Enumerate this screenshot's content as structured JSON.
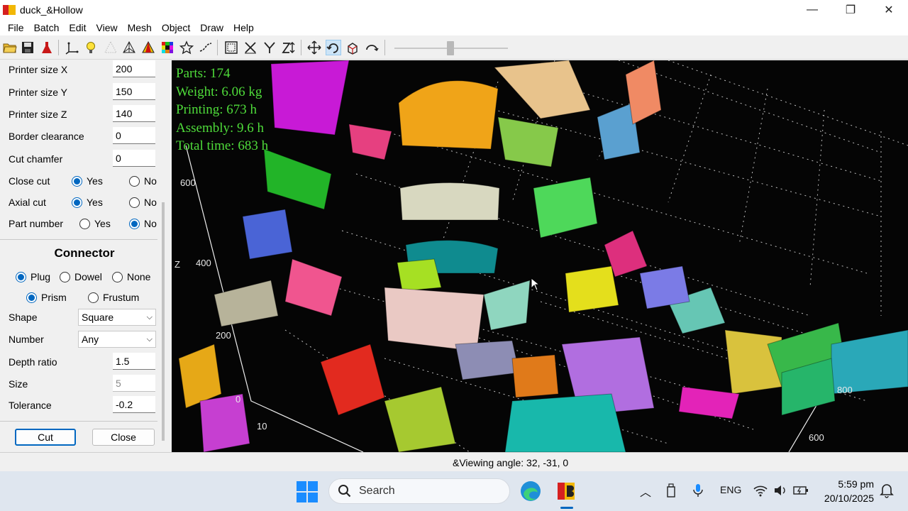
{
  "window": {
    "title": "duck_&Hollow",
    "minimize": "—",
    "maximize": "❐",
    "close": "✕"
  },
  "menu": [
    "File",
    "Batch",
    "Edit",
    "View",
    "Mesh",
    "Object",
    "Draw",
    "Help"
  ],
  "toolbar": {
    "icons": [
      "open-folder-icon",
      "save-icon",
      "flask-icon",
      "axes-icon",
      "lightbulb-icon",
      "grid-dots-icon",
      "wireframe-icon",
      "warning-triangle-icon",
      "color-grid-icon",
      "star-icon",
      "wave-icon",
      "select-box-icon",
      "cut-x-icon",
      "cut-y-icon",
      "cut-z-icon",
      "move-icon",
      "rotate-icon",
      "explode-icon",
      "undo-arc-icon"
    ],
    "zoom_level": 0.5
  },
  "panel": {
    "printer_size_x": {
      "label": "Printer size X",
      "value": "200"
    },
    "printer_size_y": {
      "label": "Printer size Y",
      "value": "150"
    },
    "printer_size_z": {
      "label": "Printer size Z",
      "value": "140"
    },
    "border_clearance": {
      "label": "Border clearance",
      "value": "0"
    },
    "cut_chamfer": {
      "label": "Cut chamfer",
      "value": "0"
    },
    "close_cut": {
      "label": "Close cut",
      "yes": "Yes",
      "no": "No",
      "selected": "Yes"
    },
    "axial_cut": {
      "label": "Axial cut",
      "yes": "Yes",
      "no": "No",
      "selected": "Yes"
    },
    "part_number": {
      "label": "Part number",
      "yes": "Yes",
      "no": "No",
      "selected": "No"
    },
    "connector_title": "Connector",
    "connector_type": {
      "plug": "Plug",
      "dowel": "Dowel",
      "none": "None",
      "selected": "Plug"
    },
    "connector_form": {
      "prism": "Prism",
      "frustum": "Frustum",
      "selected": "Prism"
    },
    "shape": {
      "label": "Shape",
      "value": "Square"
    },
    "number": {
      "label": "Number",
      "value": "Any"
    },
    "depth_ratio": {
      "label": "Depth ratio",
      "value": "1.5"
    },
    "size": {
      "label": "Size",
      "value": "5"
    },
    "tolerance": {
      "label": "Tolerance",
      "value": "-0.2"
    },
    "cut_button": "Cut",
    "close_button": "Close"
  },
  "viewport": {
    "stats": {
      "parts": "Parts: 174",
      "weight": "Weight: 6.06 kg",
      "printing": "Printing: 673 h",
      "assembly": "Assembly: 9.6 h",
      "total": "Total time: 683 h"
    },
    "axis_labels": {
      "z600": "600",
      "z400": "400",
      "z_axis": "Z",
      "z200": "200",
      "zero": "0",
      "x_100": "10",
      "y800": "800",
      "y600": "600"
    },
    "stats_color": "#4fdc3a"
  },
  "status": {
    "text": "&Viewing angle: 32, -31, 0"
  },
  "taskbar": {
    "search_label": "Search",
    "language": "ENG",
    "time": "5:59 pm",
    "date": "20/10/2025",
    "accent": "#0067c0"
  }
}
